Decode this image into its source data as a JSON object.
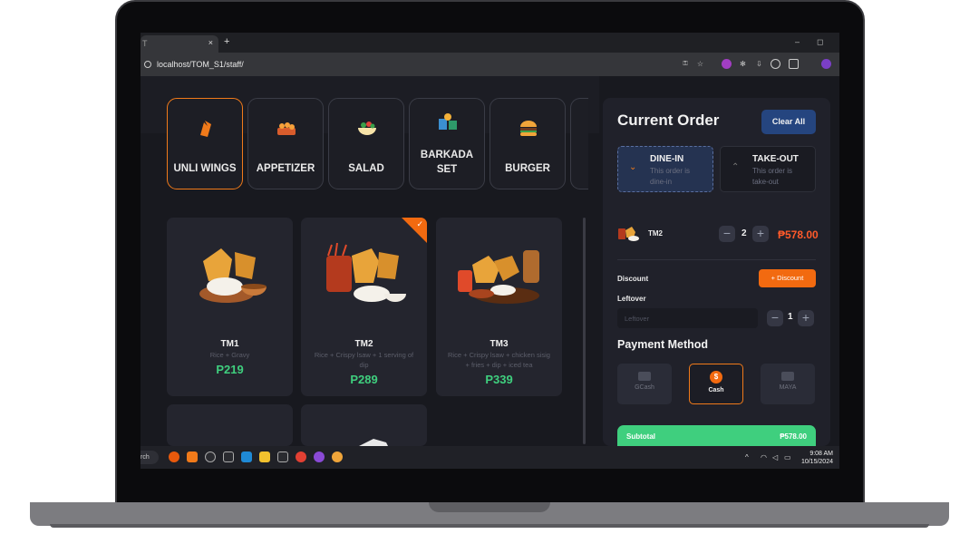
{
  "browser": {
    "tab_title": "T",
    "tab_close": "×",
    "new_tab": "+",
    "minimize": "–",
    "maximize": "◻",
    "url": "localhost/TOM_S1/staff/"
  },
  "categories": [
    {
      "label": "UNLI WINGS",
      "icon": "wings-icon",
      "active": true
    },
    {
      "label": "APPETIZER",
      "icon": "appetizer-icon"
    },
    {
      "label": "SALAD",
      "icon": "salad-icon"
    },
    {
      "label": "BARKADA SET",
      "icon": "barkada-set-icon"
    },
    {
      "label": "BURGER",
      "icon": "burger-icon"
    }
  ],
  "products": [
    {
      "name": "TM1",
      "desc": "Rice + Gravy",
      "price": "P219"
    },
    {
      "name": "TM2",
      "desc": "Rice + Crispy lsaw + 1 serving of dip",
      "price": "P289",
      "selected": true
    },
    {
      "name": "TM3",
      "desc": "Rice + Crispy lsaw + chicken sisig + fries + dip + iced tea",
      "price": "P339"
    }
  ],
  "order": {
    "title": "Current Order",
    "clear_label": "Clear All",
    "types": [
      {
        "title": "DINE-IN",
        "desc": "This order is dine-in",
        "icon": "chevron-down-icon",
        "active": true
      },
      {
        "title": "TAKE-OUT",
        "desc": "This order is take-out",
        "icon": "chevron-up-icon"
      }
    ],
    "item": {
      "name": "TM2",
      "qty": "2",
      "price": "₱578.00",
      "minus": "−",
      "plus": "+"
    },
    "discount_label": "Discount",
    "discount_button": "+ Discount",
    "leftover_label": "Leftover",
    "leftover_placeholder": "Leftover",
    "leftover_qty": "1",
    "payment_title": "Payment Method",
    "payments": [
      {
        "label": "GCash",
        "icon": "card-icon"
      },
      {
        "label": "Cash",
        "icon": "dollar-icon",
        "symbol": "$",
        "active": true
      },
      {
        "label": "MAYA",
        "icon": "wallet-icon"
      }
    ],
    "subtotal_label": "Subtotal",
    "subtotal_value": "₱578.00"
  },
  "taskbar": {
    "search_text": "rch",
    "time": "9:08 AM",
    "date": "10/15/2024"
  },
  "colors": {
    "accent": "#f07a1a",
    "price_green": "#3fcf7e",
    "order_price": "#ff5a2a",
    "clear_button": "#25457f"
  }
}
